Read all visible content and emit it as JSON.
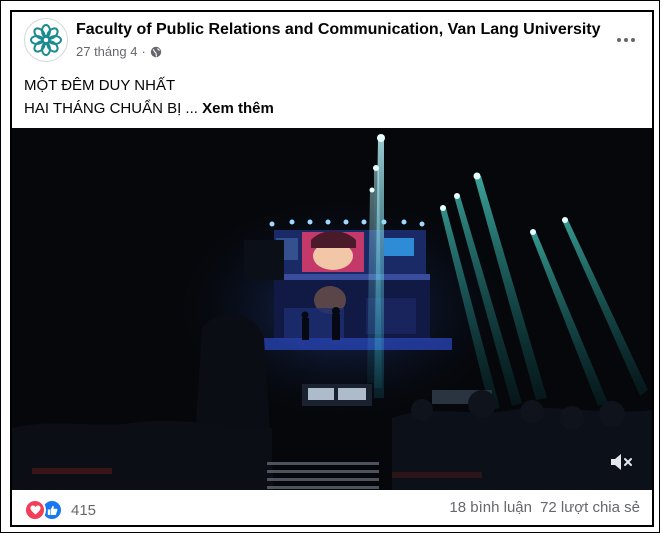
{
  "post": {
    "page_name": "Faculty of Public Relations and Communication, Van Lang University",
    "date": "27 tháng 4",
    "separator": "·",
    "privacy_icon": "globe-icon",
    "more_icon": "more-horizontal-icon",
    "text_line1": "MỘT ĐÊM DUY NHẤT",
    "text_line2": "HAI THÁNG CHUẨN BỊ",
    "ellipsis": "...",
    "see_more_label": "Xem thêm",
    "video": {
      "mute_icon": "volume-muted-icon"
    },
    "stats": {
      "reaction_count": "415",
      "comments": "18 bình luận",
      "shares": "72 lượt chia sẻ"
    },
    "colors": {
      "love": "#f33e58",
      "like": "#1877f2",
      "secondary_text": "#65676b",
      "logo": "#1b8b8f"
    }
  }
}
